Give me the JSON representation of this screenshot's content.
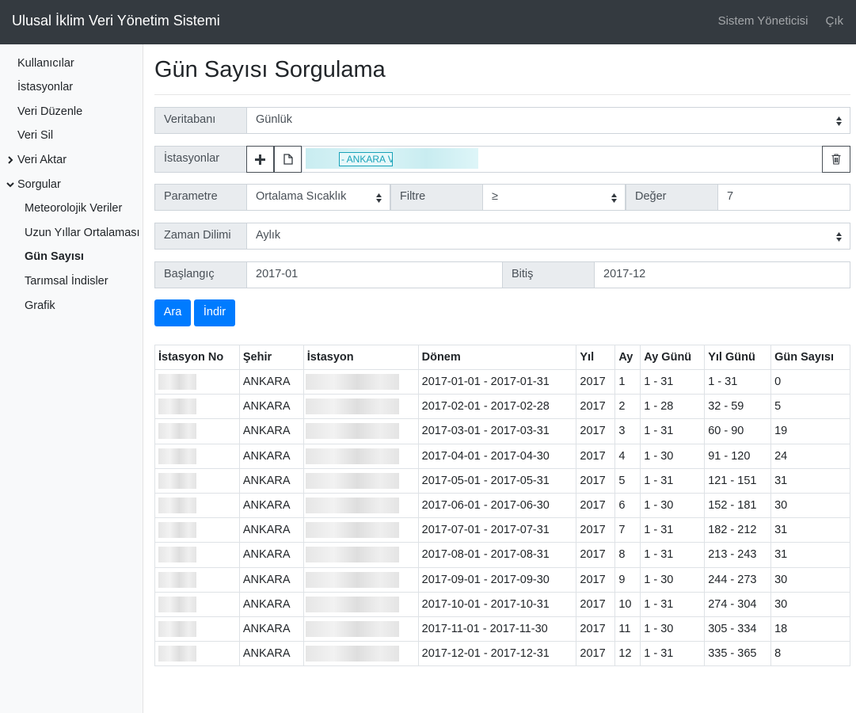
{
  "header": {
    "title": "Ulusal İklim Veri Yönetim Sistemi",
    "user_link": "Sistem Yöneticisi",
    "logout_link": "Çık"
  },
  "sidebar": {
    "items": [
      {
        "label": "Kullanıcılar"
      },
      {
        "label": "İstasyonlar"
      },
      {
        "label": "Veri Düzenle"
      },
      {
        "label": "Veri Sil"
      },
      {
        "label": "Veri Aktar"
      },
      {
        "label": "Sorgular"
      }
    ],
    "sub_items": [
      {
        "label": "Meteorolojik Veriler"
      },
      {
        "label": "Uzun Yıllar Ortalaması"
      },
      {
        "label": "Gün Sayısı",
        "active": true
      },
      {
        "label": "Tarımsal İndisler"
      },
      {
        "label": "Grafik"
      }
    ]
  },
  "page": {
    "title": "Gün Sayısı Sorgulama"
  },
  "form": {
    "database_label": "Veritabanı",
    "database_value": "Günlük",
    "stations_label": "İstasyonlar",
    "station_chip": "- ANKARA V",
    "parameter_label": "Parametre",
    "parameter_value": "Ortalama Sıcaklık",
    "filter_label": "Filtre",
    "filter_value": "≥",
    "value_label": "Değer",
    "value_value": "7",
    "period_label": "Zaman Dilimi",
    "period_value": "Aylık",
    "start_label": "Başlangıç",
    "start_value": "2017-01",
    "end_label": "Bitiş",
    "end_value": "2017-12",
    "search_button": "Ara",
    "download_button": "İndir"
  },
  "table": {
    "headers": [
      "İstasyon No",
      "Şehir",
      "İstasyon",
      "Dönem",
      "Yıl",
      "Ay",
      "Ay Günü",
      "Yıl Günü",
      "Gün Sayısı"
    ],
    "rows": [
      {
        "city": "ANKARA",
        "period": "2017-01-01 - 2017-01-31",
        "year": "2017",
        "month": "1",
        "month_days": "1 - 31",
        "year_days": "1 - 31",
        "count": "0"
      },
      {
        "city": "ANKARA",
        "period": "2017-02-01 - 2017-02-28",
        "year": "2017",
        "month": "2",
        "month_days": "1 - 28",
        "year_days": "32 - 59",
        "count": "5"
      },
      {
        "city": "ANKARA",
        "period": "2017-03-01 - 2017-03-31",
        "year": "2017",
        "month": "3",
        "month_days": "1 - 31",
        "year_days": "60 - 90",
        "count": "19"
      },
      {
        "city": "ANKARA",
        "period": "2017-04-01 - 2017-04-30",
        "year": "2017",
        "month": "4",
        "month_days": "1 - 30",
        "year_days": "91 - 120",
        "count": "24"
      },
      {
        "city": "ANKARA",
        "period": "2017-05-01 - 2017-05-31",
        "year": "2017",
        "month": "5",
        "month_days": "1 - 31",
        "year_days": "121 - 151",
        "count": "31"
      },
      {
        "city": "ANKARA",
        "period": "2017-06-01 - 2017-06-30",
        "year": "2017",
        "month": "6",
        "month_days": "1 - 30",
        "year_days": "152 - 181",
        "count": "30"
      },
      {
        "city": "ANKARA",
        "period": "2017-07-01 - 2017-07-31",
        "year": "2017",
        "month": "7",
        "month_days": "1 - 31",
        "year_days": "182 - 212",
        "count": "31"
      },
      {
        "city": "ANKARA",
        "period": "2017-08-01 - 2017-08-31",
        "year": "2017",
        "month": "8",
        "month_days": "1 - 31",
        "year_days": "213 - 243",
        "count": "31"
      },
      {
        "city": "ANKARA",
        "period": "2017-09-01 - 2017-09-30",
        "year": "2017",
        "month": "9",
        "month_days": "1 - 30",
        "year_days": "244 - 273",
        "count": "30"
      },
      {
        "city": "ANKARA",
        "period": "2017-10-01 - 2017-10-31",
        "year": "2017",
        "month": "10",
        "month_days": "1 - 31",
        "year_days": "274 - 304",
        "count": "30"
      },
      {
        "city": "ANKARA",
        "period": "2017-11-01 - 2017-11-30",
        "year": "2017",
        "month": "11",
        "month_days": "1 - 30",
        "year_days": "305 - 334",
        "count": "18"
      },
      {
        "city": "ANKARA",
        "period": "2017-12-01 - 2017-12-31",
        "year": "2017",
        "month": "12",
        "month_days": "1 - 31",
        "year_days": "335 - 365",
        "count": "8"
      }
    ]
  },
  "colors": {
    "navbar": "#343a40",
    "primary": "#007bff",
    "chip": "#17a2b8"
  }
}
